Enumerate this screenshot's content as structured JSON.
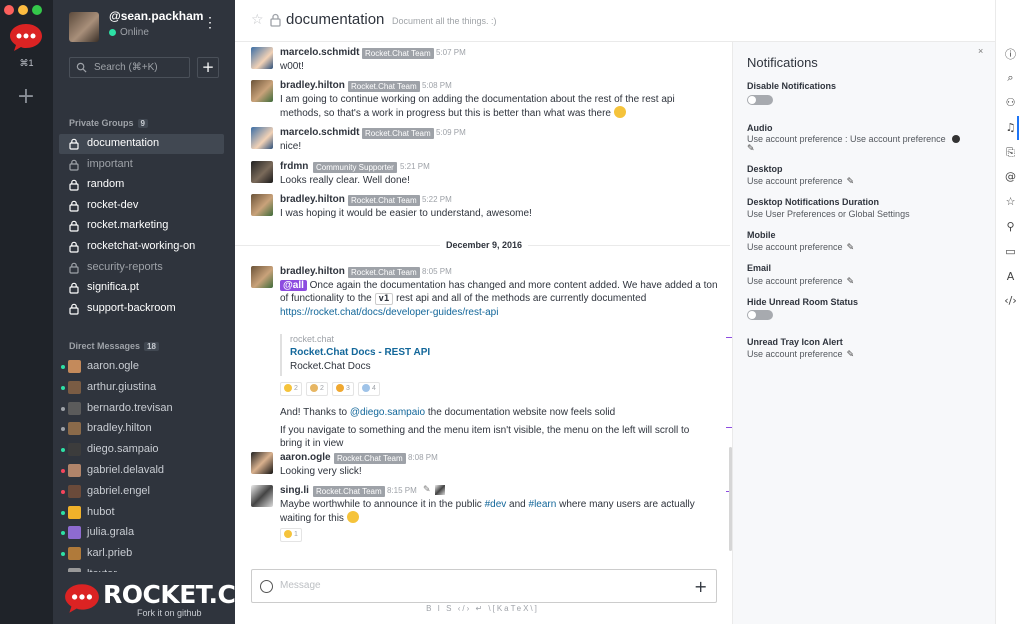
{
  "rail": {
    "shortcut": "⌘1",
    "add": "+"
  },
  "user": {
    "name": "@sean.packham",
    "status": "Online",
    "menu": "⋮"
  },
  "search": {
    "placeholder": "Search (⌘+K)",
    "new": "+"
  },
  "private_groups": {
    "title": "Private Groups",
    "count": "9",
    "items": [
      {
        "label": "documentation",
        "active": true,
        "muted": false
      },
      {
        "label": "important",
        "active": false,
        "muted": true
      },
      {
        "label": "random",
        "active": false,
        "muted": false
      },
      {
        "label": "rocket-dev",
        "active": false,
        "muted": false
      },
      {
        "label": "rocket.marketing",
        "active": false,
        "muted": false
      },
      {
        "label": "rocketchat-working-on",
        "active": false,
        "muted": false
      },
      {
        "label": "security-reports",
        "active": false,
        "muted": true
      },
      {
        "label": "significa.pt",
        "active": false,
        "muted": false
      },
      {
        "label": "support-backroom",
        "active": false,
        "muted": false
      }
    ]
  },
  "direct_messages": {
    "title": "Direct Messages",
    "count": "18",
    "items": [
      {
        "label": "aaron.ogle",
        "status": "#2de0a5"
      },
      {
        "label": "arthur.giustina",
        "status": "#2de0a5"
      },
      {
        "label": "bernardo.trevisan",
        "status": "#9ea2a8"
      },
      {
        "label": "bradley.hilton",
        "status": "#9ea2a8"
      },
      {
        "label": "diego.sampaio",
        "status": "#2de0a5"
      },
      {
        "label": "gabriel.delavald",
        "status": "#f5455c"
      },
      {
        "label": "gabriel.engel",
        "status": "#f5455c"
      },
      {
        "label": "hubot",
        "status": "#2de0a5"
      },
      {
        "label": "julia.grala",
        "status": "#2de0a5"
      },
      {
        "label": "karl.prieb",
        "status": "#2de0a5"
      },
      {
        "label": "ltexter",
        "status": "#9ea2a8"
      }
    ]
  },
  "brand": {
    "name": "ROCKET.CHAT",
    "github": "Fork it on github"
  },
  "header": {
    "star": "☆",
    "title": "documentation",
    "topic": "Document all the things. :)"
  },
  "messages": [
    {
      "user": "marcelo.schmidt",
      "role": "Rocket.Chat Team",
      "time": "5:07 PM",
      "text": "w00t!"
    },
    {
      "user": "bradley.hilton",
      "role": "Rocket.Chat Team",
      "time": "5:08 PM",
      "text": "I am going to continue working on adding the documentation about the rest of the rest api methods, so that's a work in progress but this is better than what was there"
    },
    {
      "user": "marcelo.schmidt",
      "role": "Rocket.Chat Team",
      "time": "5:09 PM",
      "text": "nice!"
    },
    {
      "user": "frdmn",
      "role": "Community Supporter",
      "time": "5:21 PM",
      "text": "Looks really clear. Well done!"
    },
    {
      "user": "bradley.hilton",
      "role": "Rocket.Chat Team",
      "time": "5:22 PM",
      "text": "I was hoping it would be easier to understand, awesome!"
    },
    {
      "user": "bradley.hilton",
      "role": "Rocket.Chat Team",
      "time": "8:05 PM",
      "mention": "@all",
      "text_a": "Once again the documentation has changed and more content added. We have added a ton of functionality to the",
      "code": "v1",
      "text_b": "rest api and all of the methods are currently documented",
      "link": "https://rocket.chat/docs/developer-guides/rest-api",
      "preview_site": "rocket.chat",
      "preview_title": "Rocket.Chat Docs - REST API",
      "preview_desc": "Rocket.Chat Docs",
      "reactions": [
        "2",
        "2",
        "3",
        "4"
      ],
      "extra1_a": "And! Thanks to",
      "extra1_mention": "@diego.sampaio",
      "extra1_b": "the documentation website now feels solid",
      "extra2": "If you navigate to something and the menu item isn't visible, the menu on the left will scroll to bring it in view"
    },
    {
      "user": "aaron.ogle",
      "role": "Rocket.Chat Team",
      "time": "8:08 PM",
      "text": "Looking very slick!"
    },
    {
      "user": "sing.li",
      "role": "Rocket.Chat Team",
      "time": "8:15 PM",
      "text_a": "Maybe worthwhile to announce it in the public",
      "ch1": "#dev",
      "and": "and",
      "ch2": "#learn",
      "text_b": "where many users are actually waiting for this",
      "reaction": "1"
    }
  ],
  "date_divider": "December 9, 2016",
  "composer": {
    "placeholder": "Message",
    "plus": "+",
    "format": "B  I  S  ‹/›  ↵  \\[KaTeX\\]"
  },
  "notifications": {
    "title": "Notifications",
    "close": "×",
    "disable_label": "Disable Notifications",
    "audio_label": "Audio",
    "audio_value": "Use account preference : Use account preference",
    "desktop_label": "Desktop",
    "desktop_value": "Use account preference",
    "duration_label": "Desktop Notifications Duration",
    "duration_value": "Use User Preferences or Global Settings",
    "mobile_label": "Mobile",
    "mobile_value": "Use account preference",
    "email_label": "Email",
    "email_value": "Use account preference",
    "hide_label": "Hide Unread Room Status",
    "tray_label": "Unread Tray Icon Alert",
    "tray_value": "Use account preference"
  },
  "colors": {
    "accent": "#1d74f5",
    "sidebar": "#2f343d",
    "rail": "#1f2329",
    "brand_red": "#db2323",
    "online": "#2de0a5"
  }
}
